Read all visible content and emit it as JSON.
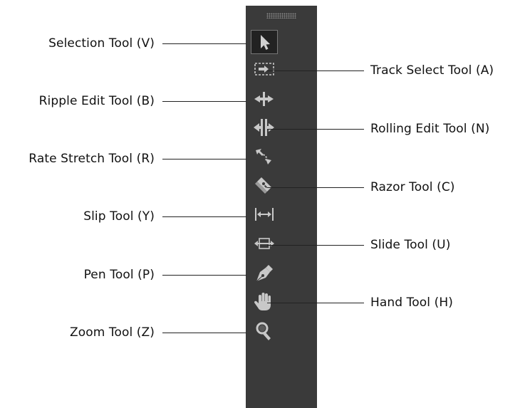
{
  "toolbar": {
    "tools": [
      {
        "id": "selection",
        "label": "Selection Tool (V)",
        "icon": "arrow-cursor-icon",
        "selected": true
      },
      {
        "id": "track-select",
        "label": "Track Select Tool (A)",
        "icon": "track-select-icon"
      },
      {
        "id": "ripple-edit",
        "label": "Ripple Edit Tool (B)",
        "icon": "ripple-edit-icon"
      },
      {
        "id": "rolling-edit",
        "label": "Rolling Edit Tool (N)",
        "icon": "rolling-edit-icon"
      },
      {
        "id": "rate-stretch",
        "label": "Rate Stretch Tool (R)",
        "icon": "rate-stretch-icon"
      },
      {
        "id": "razor",
        "label": "Razor Tool (C)",
        "icon": "razor-icon"
      },
      {
        "id": "slip",
        "label": "Slip Tool (Y)",
        "icon": "slip-icon"
      },
      {
        "id": "slide",
        "label": "Slide Tool (U)",
        "icon": "slide-icon"
      },
      {
        "id": "pen",
        "label": "Pen Tool (P)",
        "icon": "pen-icon"
      },
      {
        "id": "hand",
        "label": "Hand Tool (H)",
        "icon": "hand-icon"
      },
      {
        "id": "zoom",
        "label": "Zoom Tool (Z)",
        "icon": "magnifier-icon"
      }
    ]
  },
  "colors": {
    "panel": "#3a3a3a",
    "icon": "#c8c8c8",
    "label_text": "#111111",
    "leader_line": "#222222"
  }
}
